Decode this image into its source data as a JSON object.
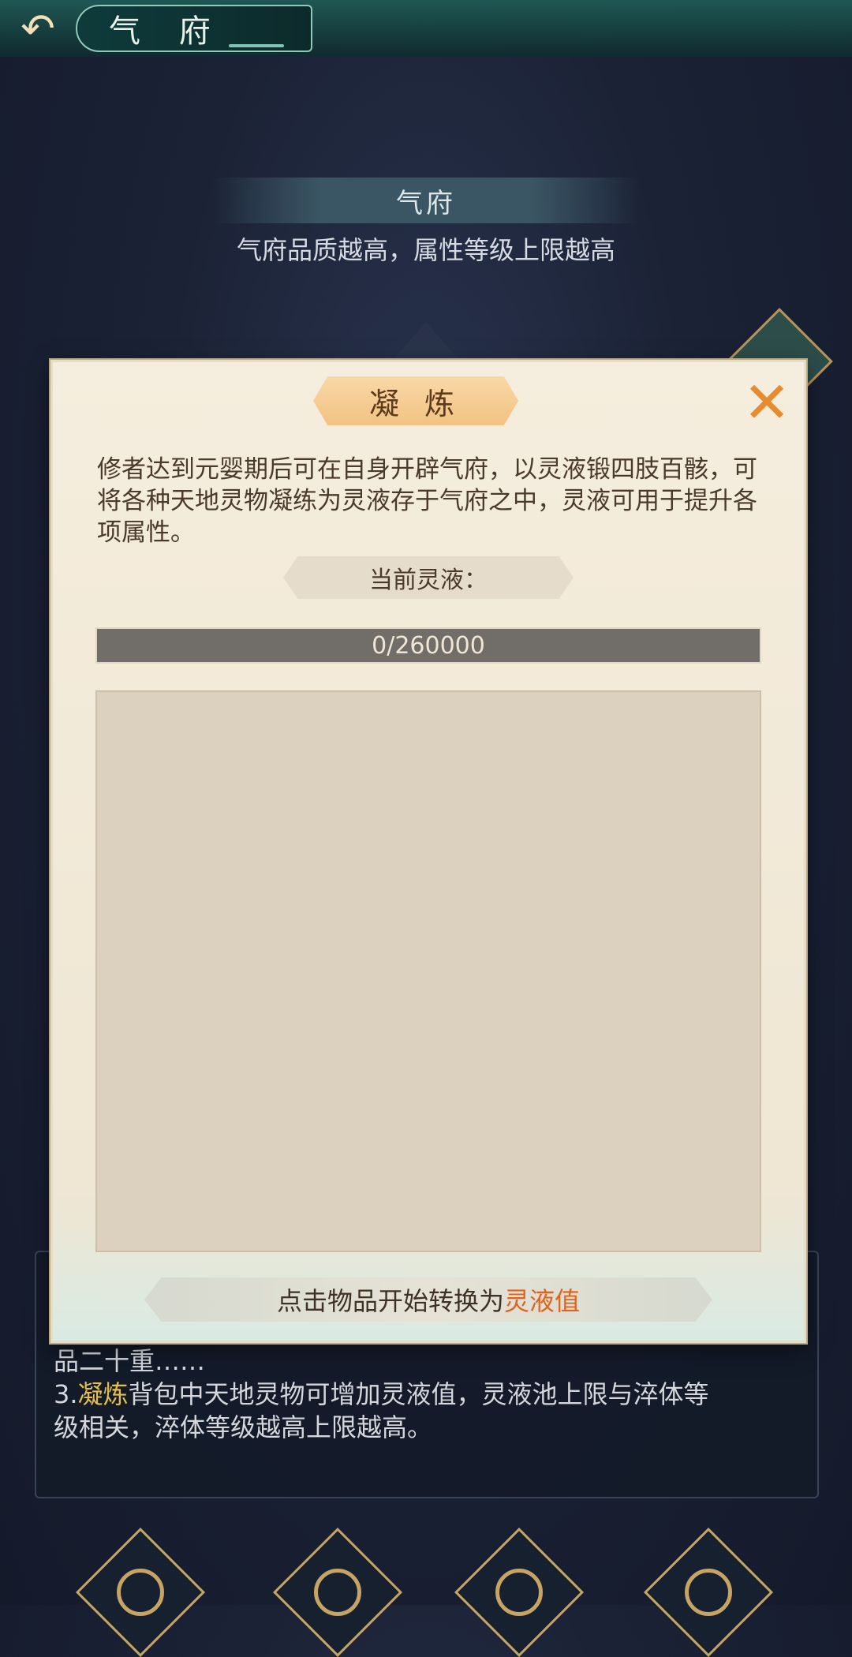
{
  "topbar": {
    "title": "气 府"
  },
  "background": {
    "banner": "气府",
    "subtitle": "气府品质越高，属性等级上限越高",
    "info_lines": [
      {
        "text": "品二十重……"
      },
      {
        "prefix": "3.",
        "highlight": "凝炼",
        "rest": "背包中天地灵物可增加灵液值，灵液池上限与淬体等"
      },
      {
        "text": "级相关，淬体等级越高上限越高。"
      }
    ]
  },
  "modal": {
    "title": "凝 炼",
    "close_icon": "close-icon",
    "description": "修者达到元婴期后可在自身开辟气府，以灵液锻四肢百骸，可将各种天地灵物凝练为灵液存于气府之中，灵液可用于提升各项属性。",
    "current_liquid_label": "当前灵液：",
    "progress": {
      "text": "0/260000",
      "current": 0,
      "max": 260000
    },
    "hint": {
      "prefix": "点击物品开始转换为",
      "highlight": "灵液值"
    }
  },
  "colors": {
    "accent": "#e0621b",
    "highlight": "#e3c04c",
    "progress_bg": "#716d68"
  },
  "bottom_nav": [
    "nav-icon-1",
    "nav-icon-2",
    "nav-icon-3",
    "nav-icon-4"
  ]
}
